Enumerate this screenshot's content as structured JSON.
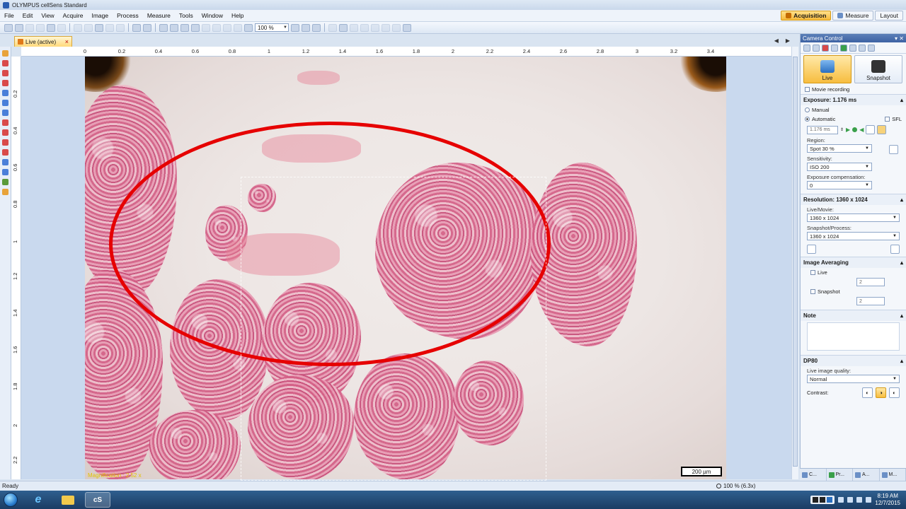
{
  "window": {
    "title": "OLYMPUS cellSens Standard"
  },
  "menubar": {
    "items": [
      "File",
      "Edit",
      "View",
      "Acquire",
      "Image",
      "Process",
      "Measure",
      "Tools",
      "Window",
      "Help"
    ],
    "modes": [
      "Acquisition",
      "Measure",
      "Layout"
    ],
    "active_mode": "Acquisition"
  },
  "toolbar": {
    "zoom": "100 %"
  },
  "document": {
    "tab_label": "Live (active)",
    "close_glyph": "×",
    "ruler_top": [
      "0",
      "0.2",
      "0.4",
      "0.6",
      "0.8",
      "1",
      "1.2",
      "1.4",
      "1.6",
      "1.8",
      "2",
      "2.2",
      "2.4",
      "2.6",
      "2.8",
      "3",
      "3.2",
      "3.4"
    ],
    "ruler_left": [
      "0.2",
      "0.4",
      "0.6",
      "0.8",
      "1",
      "1.2",
      "1.4",
      "1.6",
      "1.8",
      "2",
      "2.2"
    ],
    "magnification": "Magnification : 2.52 x",
    "scale_bar": "200 µm",
    "annotation_color": "#e60000"
  },
  "camera_control": {
    "title": "Camera Control",
    "live_label": "Live",
    "snapshot_label": "Snapshot",
    "movie_recording": "Movie recording",
    "exposure_header": "Exposure: 1.176 ms",
    "manual": "Manual",
    "automatic": "Automatic",
    "sfl": "SFL",
    "exposure_value": "1.176 ms",
    "region_label": "Region:",
    "region_value": "Spot 30 %",
    "sensitivity_label": "Sensitivity:",
    "sensitivity_value": "ISO 200",
    "exp_comp_label": "Exposure compensation:",
    "exp_comp_value": "0",
    "resolution_header": "Resolution: 1360 x 1024",
    "live_movie_label": "Live/Movie:",
    "live_movie_value": "1360 x 1024",
    "snapshot_process_label": "Snapshot/Process:",
    "snapshot_process_value": "1360 x 1024",
    "averaging_header": "Image Averaging",
    "avg_live": "Live",
    "avg_snapshot": "Snapshot",
    "avg_frames_live": "2",
    "avg_frames_snapshot": "2",
    "note_header": "Note",
    "dp80_header": "DP80",
    "live_quality_label": "Live image quality:",
    "live_quality_value": "Normal",
    "contrast_label": "Contrast:",
    "bottom_tabs": [
      "C...",
      "Pr...",
      "A...",
      "M..."
    ]
  },
  "status": {
    "ready": "Ready",
    "zoom": "100 % (6.3x)"
  },
  "taskbar": {
    "cs_label": "cS",
    "time": "8:19 AM",
    "date": "12/7/2015"
  }
}
